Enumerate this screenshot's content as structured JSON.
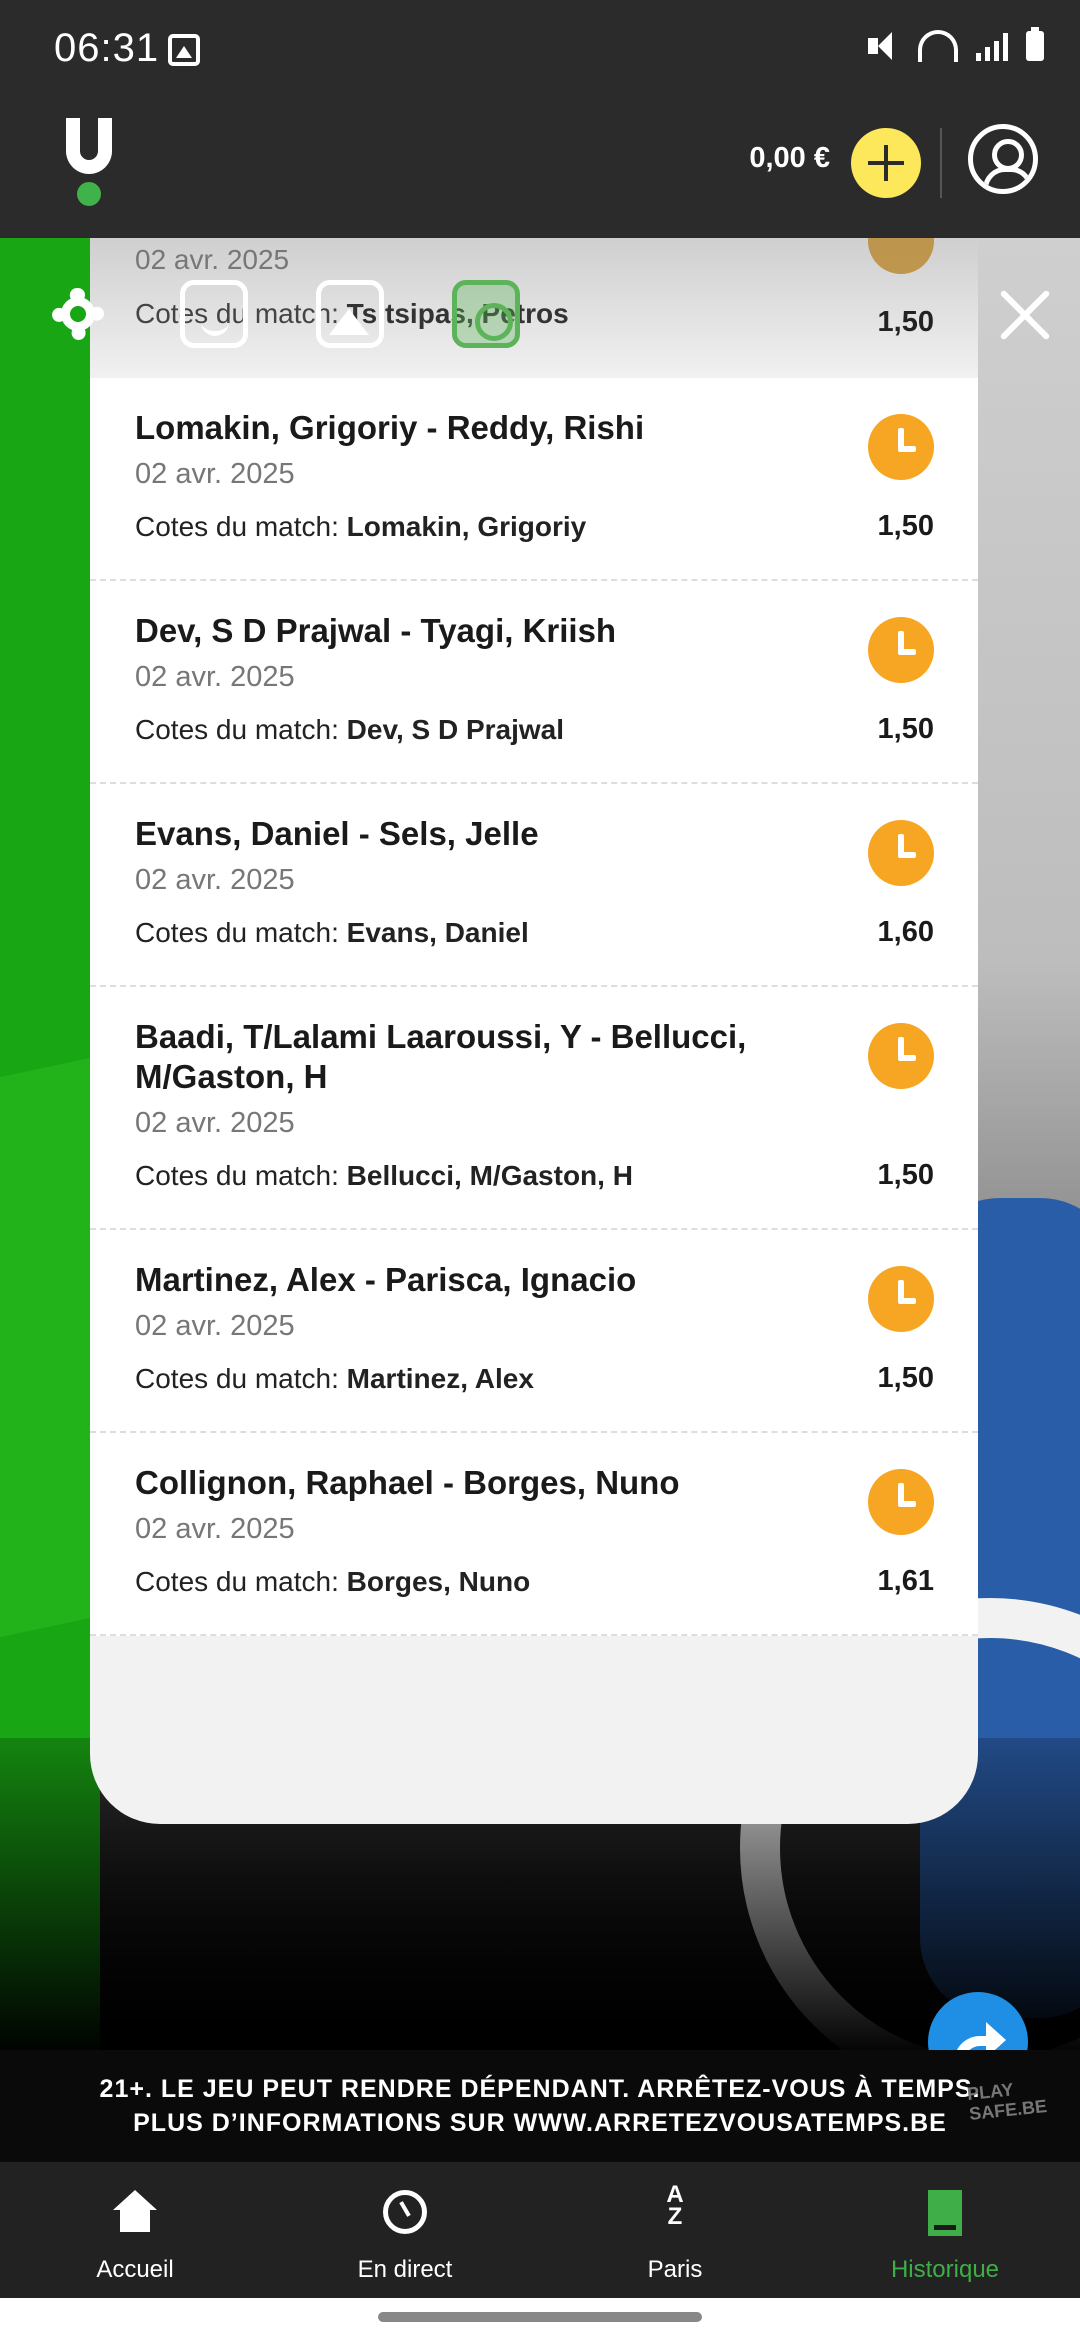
{
  "status_bar": {
    "time": "06:31"
  },
  "header": {
    "balance": "0,00 €"
  },
  "sheet": {
    "ghost_item": {
      "date": "02 avr. 2025",
      "cotes_label": "Cotes du match:",
      "pick": "Tsitsipas, Petros",
      "odd": "1,50"
    },
    "items": [
      {
        "title": "Lomakin, Grigoriy - Reddy, Rishi",
        "date": "02 avr. 2025",
        "cotes_label": "Cotes du match:",
        "pick": "Lomakin, Grigoriy",
        "odd": "1,50"
      },
      {
        "title": "Dev, S D Prajwal - Tyagi, Kriish",
        "date": "02 avr. 2025",
        "cotes_label": "Cotes du match:",
        "pick": "Dev, S D Prajwal",
        "odd": "1,50"
      },
      {
        "title": "Evans, Daniel - Sels, Jelle",
        "date": "02 avr. 2025",
        "cotes_label": "Cotes du match:",
        "pick": "Evans, Daniel",
        "odd": "1,60"
      },
      {
        "title": "Baadi, T/Lalami Laaroussi, Y - Bellucci, M/Gaston, H",
        "date": "02 avr. 2025",
        "cotes_label": "Cotes du match:",
        "pick": "Bellucci, M/Gaston, H",
        "odd": "1,50"
      },
      {
        "title": "Martinez, Alex - Parisca, Ignacio",
        "date": "02 avr. 2025",
        "cotes_label": "Cotes du match:",
        "pick": "Martinez, Alex",
        "odd": "1,50"
      },
      {
        "title": "Collignon, Raphael - Borges, Nuno",
        "date": "02 avr. 2025",
        "cotes_label": "Cotes du match:",
        "pick": "Borges, Nuno",
        "odd": "1,61"
      }
    ]
  },
  "warning": {
    "line1": "21+. LE JEU PEUT RENDRE DÉPENDANT. ARRÊTEZ-VOUS À TEMPS.",
    "line2": "PLUS D’INFORMATIONS SUR WWW.ARRETEZVOUSATEMPS.BE",
    "logo_text": "PLAY SAFE.BE"
  },
  "bottom_nav": [
    {
      "label": "Accueil",
      "icon": "home-icon"
    },
    {
      "label": "En direct",
      "icon": "live-icon"
    },
    {
      "label": "Paris",
      "icon": "az-icon"
    },
    {
      "label": "Historique",
      "icon": "history-icon",
      "active": true
    }
  ],
  "colors": {
    "accent_green": "#3fae49",
    "clock_orange": "#f6a623",
    "add_yellow": "#fce85a",
    "fab_blue": "#1f8fe6"
  }
}
